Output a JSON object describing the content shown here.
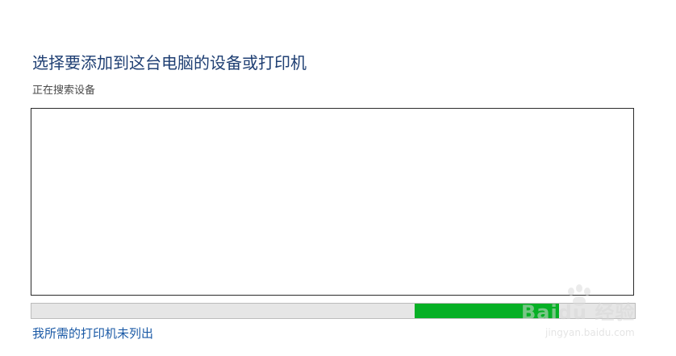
{
  "header": {
    "title": "选择要添加到这台电脑的设备或打印机",
    "status": "正在搜索设备"
  },
  "search_progress": {
    "indeterminate": true,
    "color": "#06b025"
  },
  "footer": {
    "printer_not_listed_link": "我所需的打印机未列出"
  },
  "watermark": {
    "brand": "Baidu 经验",
    "url": "jingyan.baidu.com"
  },
  "colors": {
    "title": "#1f3f73",
    "link": "#1b5aa6",
    "progress_fill": "#06b025",
    "progress_track": "#e6e6e6"
  }
}
